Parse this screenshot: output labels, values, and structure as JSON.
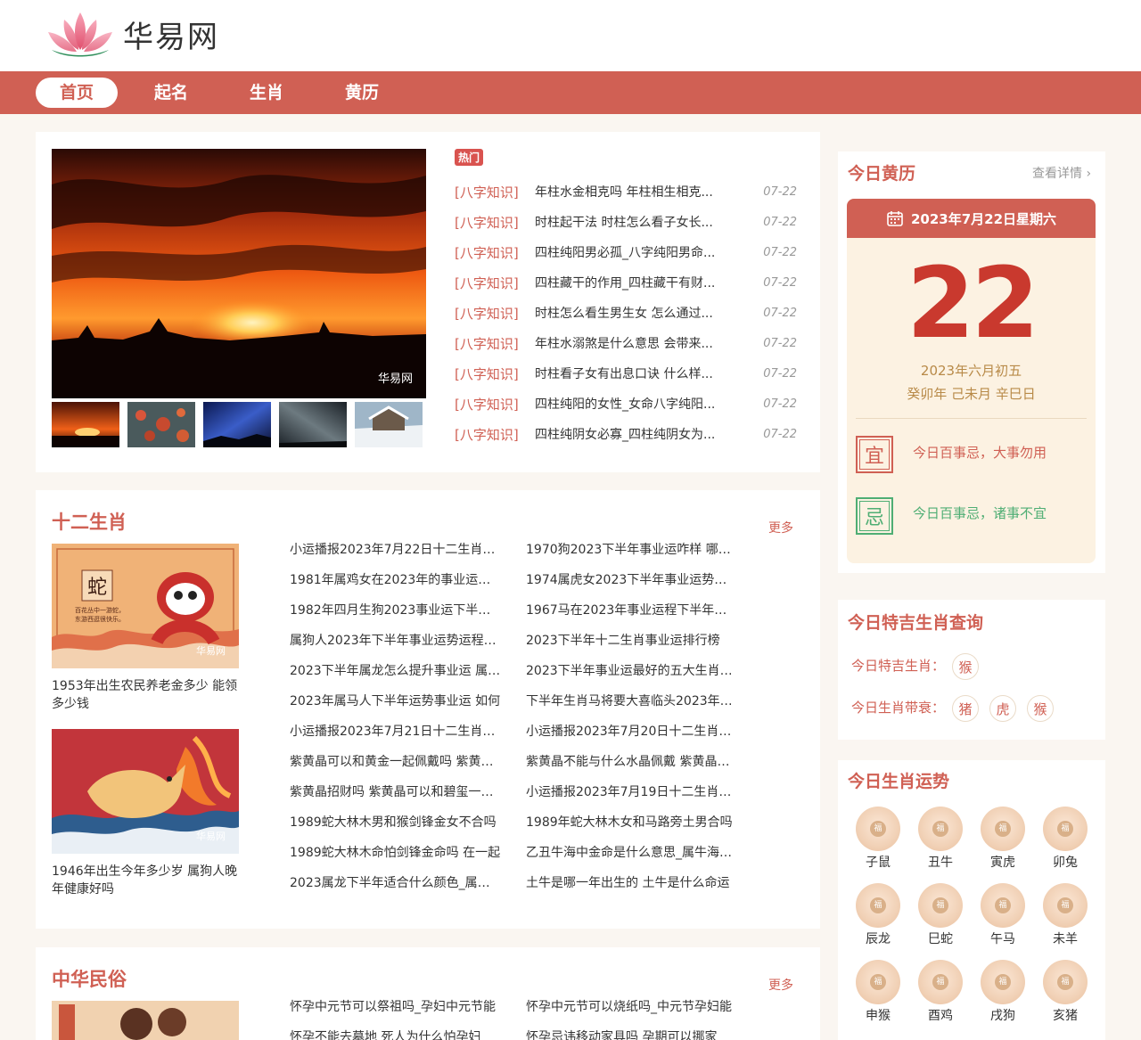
{
  "site": {
    "name": "华易网"
  },
  "nav": [
    "首页",
    "起名",
    "生肖",
    "黄历"
  ],
  "featured": {
    "hot_badge": "热门",
    "watermark": "华易网",
    "news": [
      {
        "cat": "[八字知识]",
        "title": "年柱水金相克吗 年柱相生相克...",
        "date": "07-22"
      },
      {
        "cat": "[八字知识]",
        "title": "时柱起干法 时柱怎么看子女长...",
        "date": "07-22"
      },
      {
        "cat": "[八字知识]",
        "title": "四柱纯阳男必孤_八字纯阳男命...",
        "date": "07-22"
      },
      {
        "cat": "[八字知识]",
        "title": "四柱藏干的作用_四柱藏干有财...",
        "date": "07-22"
      },
      {
        "cat": "[八字知识]",
        "title": "时柱怎么看生男生女 怎么通过...",
        "date": "07-22"
      },
      {
        "cat": "[八字知识]",
        "title": "年柱水溺煞是什么意思 会带来...",
        "date": "07-22"
      },
      {
        "cat": "[八字知识]",
        "title": "时柱看子女有出息口诀 什么样...",
        "date": "07-22"
      },
      {
        "cat": "[八字知识]",
        "title": "四柱纯阳的女性_女命八字纯阳...",
        "date": "07-22"
      },
      {
        "cat": "[八字知识]",
        "title": "四柱纯阴女必寡_四柱纯阴女为...",
        "date": "07-22"
      }
    ]
  },
  "zodiac_section": {
    "title": "十二生肖",
    "more": "更多",
    "pic1_char": "蛇",
    "pic1_poem": "百花丛中一游蛇，东游西逛很快乐。",
    "pic_watermark": "华易网",
    "caption1": "1953年出生农民养老金多少 能领多少钱",
    "caption2": "1946年出生今年多少岁 属狗人晚年健康好吗",
    "col1": [
      "小运播报2023年7月22日十二生肖运势",
      "1981年属鸡女在2023年的事业运下半年",
      "1982年四月生狗2023事业运下半年如何",
      "属狗人2023年下半年事业运势运程如何",
      "2023下半年属龙怎么提升事业运 属龙人",
      "2023年属马人下半年运势事业运 如何",
      "小运播报2023年7月21日十二生肖运势",
      "紫黄晶可以和黄金一起佩戴吗 紫黄晶的",
      "紫黄晶招财吗 紫黄晶可以和碧玺一起戴",
      "1989蛇大林木男和猴剑锋金女不合吗",
      "1989蛇大林木命怕剑锋金命吗 在一起",
      "2023属龙下半年适合什么颜色_属龙人"
    ],
    "col2": [
      "1970狗2023下半年事业运咋样 哪个月",
      "1974属虎女2023下半年事业运势好吗",
      "1967马在2023年事业运程下半年发展",
      "2023下半年十二生肖事业运排行榜",
      "2023下半年事业运最好的五大生肖排行",
      "下半年生肖马将要大喜临头2023年事业",
      "小运播报2023年7月20日十二生肖运势",
      "紫黄晶不能与什么水晶佩戴 紫黄晶禁忌",
      "小运播报2023年7月19日十二生肖运势",
      "1989年蛇大林木女和马路旁土男合吗",
      "乙丑牛海中金命是什么意思_属牛海中金",
      "土牛是哪一年出生的 土牛是什么命运"
    ]
  },
  "folk_section": {
    "title": "中华民俗",
    "more": "更多",
    "col1": [
      "怀孕中元节可以祭祖吗_孕妇中元节能",
      "怀孕不能去墓地 死人为什么怕孕妇"
    ],
    "col2": [
      "怀孕中元节可以烧纸吗_中元节孕妇能",
      "怀孕忌讳移动家具吗 孕期可以挪家"
    ]
  },
  "almanac": {
    "title": "今日黄历",
    "more": "查看详情",
    "date_line": "2023年7月22日星期六",
    "day": "22",
    "lunar": "2023年六月初五",
    "ganzhi": "癸卯年 己未月 辛巳日",
    "yi_char": "宜",
    "yi_text": "今日百事忌，大事勿用",
    "ji_char": "忌",
    "ji_text": "今日百事忌，诸事不宜",
    "yi_color": "#d06054",
    "ji_color": "#4fae74"
  },
  "lucky": {
    "title": "今日特吉生肖查询",
    "lucky_label": "今日特吉生肖：",
    "lucky": [
      "猴"
    ],
    "bad_label": "今日生肖带衰：",
    "bad": [
      "猪",
      "虎",
      "猴"
    ]
  },
  "fortune": {
    "title": "今日生肖运势",
    "badge_icon": "福",
    "items": [
      "子鼠",
      "丑牛",
      "寅虎",
      "卯兔",
      "辰龙",
      "巳蛇",
      "午马",
      "未羊",
      "申猴",
      "酉鸡",
      "戌狗",
      "亥猪"
    ]
  }
}
